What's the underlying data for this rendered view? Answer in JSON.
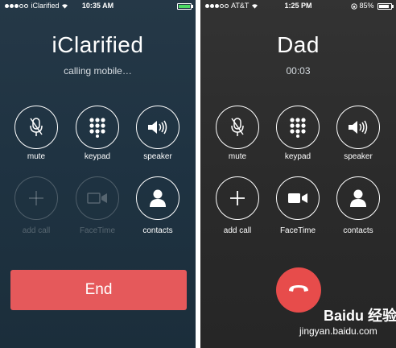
{
  "left_phone": {
    "status": {
      "carrier": "iClarified",
      "time": "10:35 AM"
    },
    "caller_name": "iClarified",
    "call_status": "calling mobile…",
    "buttons": [
      {
        "label": "mute",
        "icon": "mute-icon",
        "enabled": true
      },
      {
        "label": "keypad",
        "icon": "keypad-icon",
        "enabled": true
      },
      {
        "label": "speaker",
        "icon": "speaker-icon",
        "enabled": true
      },
      {
        "label": "add call",
        "icon": "add-call-icon",
        "enabled": false
      },
      {
        "label": "FaceTime",
        "icon": "facetime-icon",
        "enabled": false
      },
      {
        "label": "contacts",
        "icon": "contacts-icon",
        "enabled": true
      }
    ],
    "end_label": "End",
    "battery_color": "#4cd964"
  },
  "right_phone": {
    "status": {
      "carrier": "AT&T",
      "time": "1:25 PM",
      "battery": "85%"
    },
    "caller_name": "Dad",
    "call_duration": "00:03",
    "buttons": [
      {
        "label": "mute",
        "icon": "mute-icon",
        "enabled": true
      },
      {
        "label": "keypad",
        "icon": "keypad-icon",
        "enabled": true
      },
      {
        "label": "speaker",
        "icon": "speaker-icon",
        "enabled": true
      },
      {
        "label": "add call",
        "icon": "add-call-icon",
        "enabled": true
      },
      {
        "label": "FaceTime",
        "icon": "facetime-icon",
        "enabled": true
      },
      {
        "label": "contacts",
        "icon": "contacts-icon",
        "enabled": true
      }
    ],
    "end_icon": "hang-up-icon",
    "end_color": "#e74c4b"
  },
  "watermark": {
    "brand": "Baidu 经验",
    "url": "jingyan.baidu.com"
  }
}
